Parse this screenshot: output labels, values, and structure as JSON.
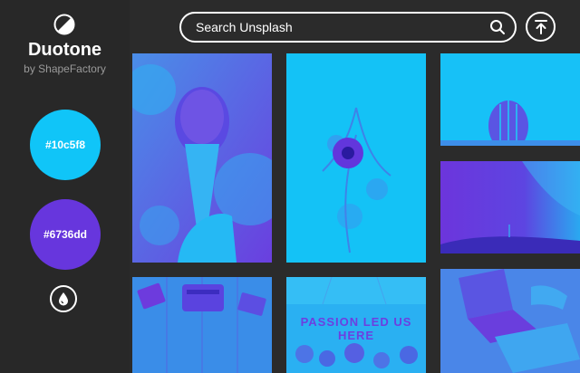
{
  "app": {
    "title": "Duotone",
    "subtitle": "by ShapeFactory"
  },
  "colors": {
    "accent_one": "#10c5f8",
    "accent_two": "#6736dd",
    "background": "#2b2b2b",
    "sidebar": "#282828"
  },
  "swatches": [
    {
      "label": "#10c5f8",
      "color": "#10c5f8"
    },
    {
      "label": "#6736dd",
      "color": "#6736dd"
    }
  ],
  "search": {
    "placeholder": "Search Unsplash",
    "value": ""
  },
  "icons": {
    "logo": "half-filled-circle-icon",
    "search": "magnifier-icon",
    "upload": "arrow-up-to-line-icon",
    "drop": "water-drop-icon"
  },
  "gallery": {
    "tiles": [
      {
        "subject": "ice cream cone"
      },
      {
        "subject": "dried flower arrangement"
      },
      {
        "subject": "cactus"
      },
      {
        "subject": "starry night sky"
      },
      {
        "subject": "typewriter desk"
      },
      {
        "subject": "crowd sign",
        "sign_text": "PASSION LED US HERE"
      },
      {
        "subject": "laptop workspace"
      }
    ]
  }
}
